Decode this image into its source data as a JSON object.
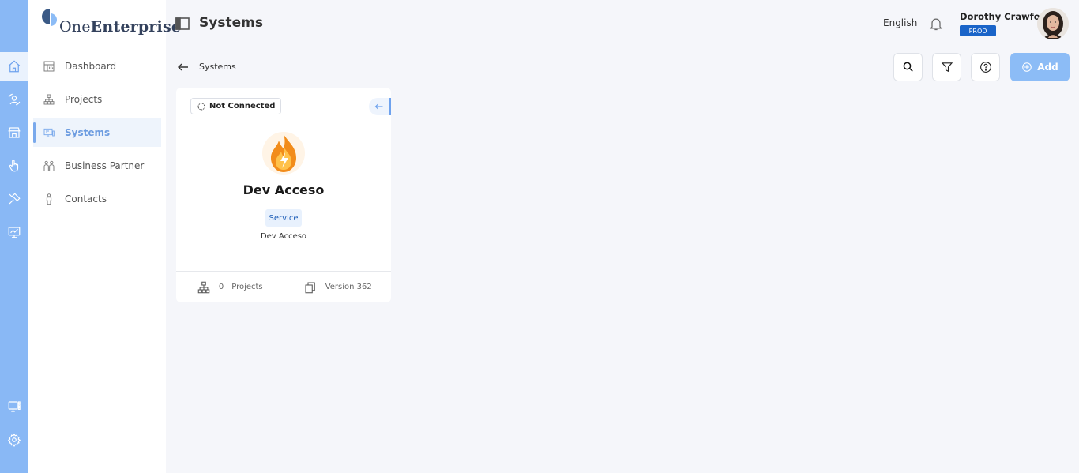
{
  "app": {
    "logo_prefix": "One",
    "logo_bold": "Enterprise"
  },
  "rail": {
    "items": [
      {
        "icon": "home-icon"
      },
      {
        "icon": "user-switch-icon"
      },
      {
        "icon": "store-icon"
      },
      {
        "icon": "hand-pointer-icon"
      },
      {
        "icon": "tools-icon"
      },
      {
        "icon": "monitor-chart-icon"
      },
      {
        "icon": "monitor-grid-icon"
      },
      {
        "icon": "gear-icon"
      }
    ]
  },
  "sidebar": {
    "items": [
      {
        "label": "Dashboard",
        "icon": "dashboard-icon"
      },
      {
        "label": "Projects",
        "icon": "sitemap-icon"
      },
      {
        "label": "Systems",
        "icon": "systems-icon",
        "active": true
      },
      {
        "label": "Business Partner",
        "icon": "partners-icon"
      },
      {
        "label": "Contacts",
        "icon": "person-icon"
      }
    ]
  },
  "header": {
    "title": "Systems",
    "language": "English",
    "user_name": "Dorothy Crawford",
    "environment": "PROD"
  },
  "toolbar": {
    "breadcrumb": "Systems",
    "add_label": "Add"
  },
  "colors": {
    "accent": "#89b8f5",
    "prod_badge": "#1a64c8",
    "add_button": "#8cbcf6",
    "tag_text": "#1f5fb8"
  },
  "card": {
    "status": "Not Connected",
    "name": "Dev Acceso",
    "tag": "Service",
    "description": "Dev Acceso",
    "projects_count": "0",
    "projects_label": "Projects",
    "version": "Version 362"
  }
}
